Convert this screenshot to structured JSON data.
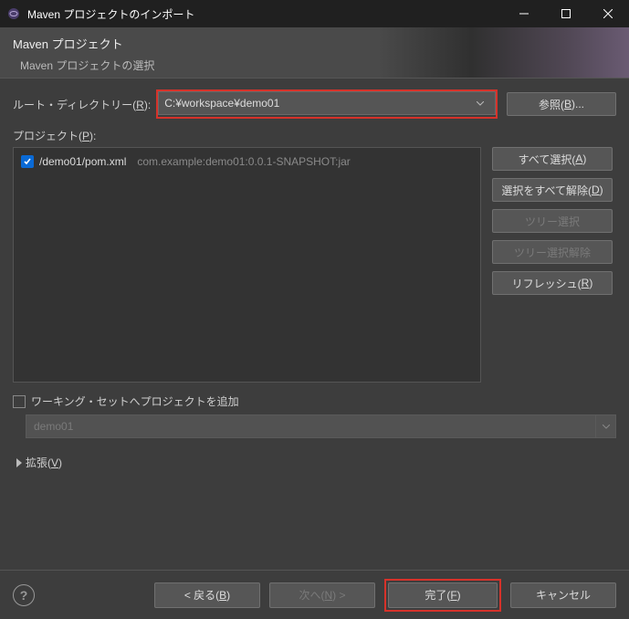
{
  "titlebar": {
    "title": "Maven プロジェクトのインポート"
  },
  "wizard": {
    "heading": "Maven プロジェクト",
    "subheading": "Maven プロジェクトの選択"
  },
  "root": {
    "label_pre": "ルート・ディレクトリー(",
    "label_mn": "R",
    "label_post": "):",
    "value": "C:¥workspace¥demo01",
    "browse_pre": "参照(",
    "browse_mn": "B",
    "browse_post": ")..."
  },
  "projects": {
    "label_pre": "プロジェクト(",
    "label_mn": "P",
    "label_post": "):",
    "items": [
      {
        "checked": true,
        "path": "/demo01/pom.xml",
        "gav": "com.example:demo01:0.0.1-SNAPSHOT:jar"
      }
    ]
  },
  "side": {
    "select_all_pre": "すべて選択(",
    "select_all_mn": "A",
    "select_all_post": ")",
    "deselect_all_pre": "選択をすべて解除(",
    "deselect_all_mn": "D",
    "deselect_all_post": ")",
    "tree_select": "ツリー選択",
    "tree_deselect": "ツリー選択解除",
    "refresh_pre": "リフレッシュ(",
    "refresh_mn": "R",
    "refresh_post": ")"
  },
  "workingset": {
    "label": "ワーキング・セットへプロジェクトを追加",
    "value": "demo01"
  },
  "expand": {
    "label_pre": "拡張(",
    "label_mn": "V",
    "label_post": ")"
  },
  "footer": {
    "back_pre": "< 戻る(",
    "back_mn": "B",
    "back_post": ")",
    "next_pre": "次へ(",
    "next_mn": "N",
    "next_post": ") >",
    "finish_pre": "完了(",
    "finish_mn": "F",
    "finish_post": ")",
    "cancel": "キャンセル"
  }
}
